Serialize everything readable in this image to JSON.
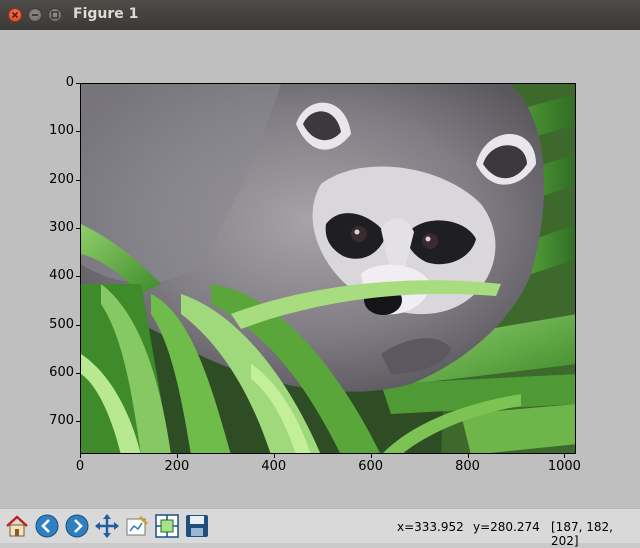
{
  "window": {
    "title": "Figure 1"
  },
  "axes": {
    "y_ticks": [
      "0",
      "100",
      "200",
      "300",
      "400",
      "500",
      "600",
      "700"
    ],
    "x_ticks": [
      "0",
      "200",
      "400",
      "600",
      "800",
      "1000"
    ]
  },
  "toolbar": {
    "buttons": [
      "home-icon",
      "back-arrow-icon",
      "forward-arrow-icon",
      "pan-icon",
      "edit-axis-icon",
      "subplots-icon",
      "save-icon"
    ],
    "coord_x": "x=333.952",
    "coord_y": "y=280.274",
    "pixel_value": "[187, 182, 202]"
  },
  "image": {
    "subject": "raccoon among green leaves"
  }
}
